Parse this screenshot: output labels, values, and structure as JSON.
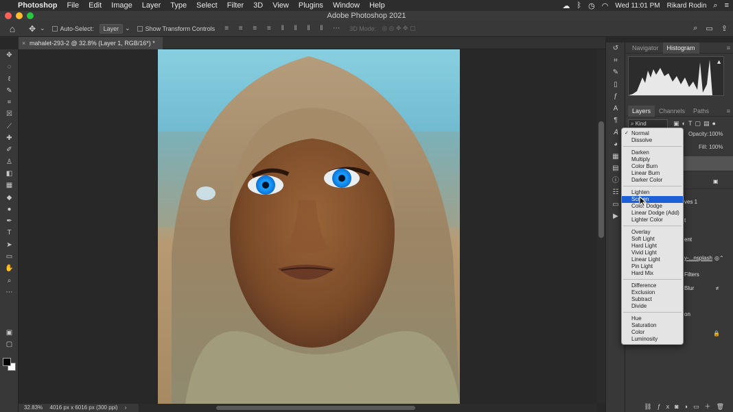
{
  "menubar": {
    "apple": "",
    "app_name": "Photoshop",
    "menus": [
      "File",
      "Edit",
      "Image",
      "Layer",
      "Type",
      "Select",
      "Filter",
      "3D",
      "View",
      "Plugins",
      "Window",
      "Help"
    ],
    "clock": "Wed 11:01 PM",
    "user": "Rikard Rodin"
  },
  "window": {
    "title": "Adobe Photoshop 2021",
    "traffic_lights": [
      "#fe5f57",
      "#febc2e",
      "#28c840"
    ]
  },
  "options_bar": {
    "auto_select_label": "Auto-Select:",
    "auto_select_value": "Layer",
    "transform_label": "Show Transform Controls",
    "mode_3d_label": "3D Mode:"
  },
  "document": {
    "tab_title": "mahalet-293-2 @ 32.8% (Layer 1, RGB/16*) *",
    "zoom": "32.83%",
    "dimensions": "4016 px x 6016 px (300 ppi)"
  },
  "panels": {
    "top_tabs": [
      "Navigator",
      "Histogram"
    ],
    "top_active": "Histogram",
    "layer_tabs": [
      "Layers",
      "Channels",
      "Paths"
    ],
    "layer_active": "Layers",
    "kind_label": "Kind",
    "opacity_label": "Opacity:",
    "opacity_value": "100%",
    "fill_label": "Fill:",
    "fill_value": "100%"
  },
  "layers_partial": {
    "curves": "ves 1",
    "row_t": "t",
    "row_ent": "ent",
    "smart_object": "y-...nsplash",
    "filters": "Filters",
    "blur": "Blur",
    "row_on": "on"
  },
  "blend_modes": {
    "selected": "Normal",
    "highlighted": "Screen",
    "groups": [
      [
        "Normal",
        "Dissolve"
      ],
      [
        "Darken",
        "Multiply",
        "Color Burn",
        "Linear Burn",
        "Darker Color"
      ],
      [
        "Lighten",
        "Screen",
        "Color Dodge",
        "Linear Dodge (Add)",
        "Lighter Color"
      ],
      [
        "Overlay",
        "Soft Light",
        "Hard Light",
        "Vivid Light",
        "Linear Light",
        "Pin Light",
        "Hard Mix"
      ],
      [
        "Difference",
        "Exclusion",
        "Subtract",
        "Divide"
      ],
      [
        "Hue",
        "Saturation",
        "Color",
        "Luminosity"
      ]
    ]
  },
  "colors": {
    "highlight": "#1d5fd6",
    "foreground_swatch": "#000000",
    "background_swatch": "#ffffff"
  }
}
